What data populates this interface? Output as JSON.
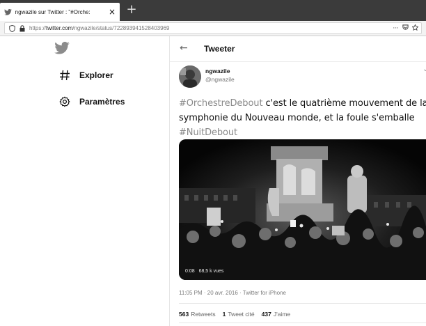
{
  "browser": {
    "tab_title": "ngwazile sur Twitter : \"#Orche:",
    "tab_close": "×",
    "new_tab": "+",
    "url_prefix": "https://",
    "url_host": "twitter.com",
    "url_path": "/ngwazile/status/722893941528403969",
    "url_more": "···"
  },
  "sidebar": {
    "items": [
      {
        "label": "Explorer",
        "icon": "hashtag-icon"
      },
      {
        "label": "Paramètres",
        "icon": "gear-icon"
      }
    ]
  },
  "header": {
    "back": "←",
    "title": "Tweeter"
  },
  "tweet": {
    "display_name": "ngwazile",
    "handle": "@ngwazile",
    "hashtag1": "#OrchestreDebout",
    "text_part1": " c'est le quatrième mouvement de la symphonie du Nouveau monde, et la foule s'emballe",
    "hashtag2": "#NuitDebout",
    "video_time": "0:08",
    "video_views": "68,5 k vues",
    "timestamp": "11:05 PM · 20 avr. 2016 · Twitter for iPhone",
    "stats": {
      "retweets_count": "563",
      "retweets_label": "Retweets",
      "quotes_count": "1",
      "quotes_label": "Tweet cité",
      "likes_count": "437",
      "likes_label": "J'aime"
    }
  },
  "colors": {
    "hashtag": "#8a8a8a",
    "chrome_dark": "#3b3b3b"
  }
}
